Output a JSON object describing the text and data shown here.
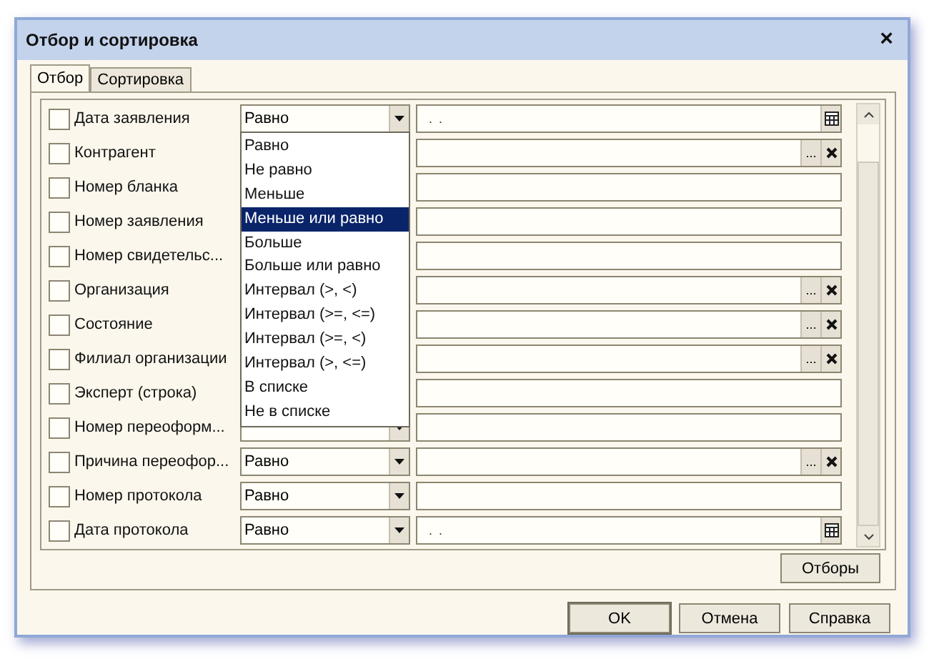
{
  "window": {
    "title": "Отбор и сортировка",
    "close": "×"
  },
  "tabs": [
    {
      "label": "Отбор",
      "selected": true
    },
    {
      "label": "Сортировка",
      "selected": false
    }
  ],
  "rows": [
    {
      "checked": false,
      "name": "Дата заявления",
      "condition": "Равно",
      "kind": "date",
      "value": ". ."
    },
    {
      "checked": false,
      "name": "Контрагент",
      "kind": "ref",
      "select_button": "..."
    },
    {
      "checked": false,
      "name": "Номер бланка",
      "kind": "plain"
    },
    {
      "checked": false,
      "name": "Номер заявления",
      "kind": "plain"
    },
    {
      "checked": false,
      "name": "Номер свидетельс...",
      "kind": "plain"
    },
    {
      "checked": false,
      "name": "Организация",
      "kind": "ref",
      "select_button": "..."
    },
    {
      "checked": false,
      "name": "Состояние",
      "kind": "ref",
      "select_button": "..."
    },
    {
      "checked": false,
      "name": "Филиал организации",
      "kind": "ref",
      "select_button": "..."
    },
    {
      "checked": false,
      "name": "Эксперт (строка)",
      "kind": "plain"
    },
    {
      "checked": false,
      "name": "Номер переоформ...",
      "kind": "plain"
    },
    {
      "checked": false,
      "name": "Причина переофор...",
      "condition": "Равно",
      "kind": "ref",
      "select_button": "..."
    },
    {
      "checked": false,
      "name": "Номер протокола",
      "condition": "Равно",
      "kind": "plain"
    },
    {
      "checked": false,
      "name": "Дата протокола",
      "condition": "Равно",
      "kind": "date",
      "value": ". ."
    }
  ],
  "condition_menu": [
    {
      "label": "Равно",
      "selected": false
    },
    {
      "label": "Не равно",
      "selected": false
    },
    {
      "label": "Меньше",
      "selected": false
    },
    {
      "label": "Меньше или равно",
      "selected": true
    },
    {
      "label": "Больше",
      "selected": false
    },
    {
      "label": "Больше или равно",
      "selected": false
    },
    {
      "label": "Интервал (>, <)",
      "selected": false
    },
    {
      "label": "Интервал (>=, <=)",
      "selected": false
    },
    {
      "label": "Интервал (>=, <)",
      "selected": false
    },
    {
      "label": "Интервал (>, <=)",
      "selected": false
    },
    {
      "label": "В списке",
      "selected": false
    },
    {
      "label": "Не в списке",
      "selected": false
    }
  ],
  "filters_button": "Отборы",
  "buttons": [
    "OK",
    "Отмена",
    "Справка"
  ]
}
